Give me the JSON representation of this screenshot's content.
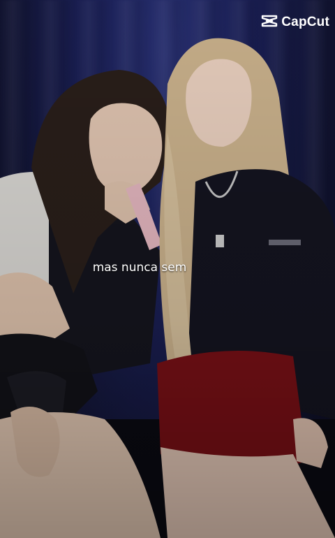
{
  "watermark": {
    "text": "CapCut",
    "icon": "capcut-logo-icon"
  },
  "caption": {
    "text": "mas nunca sem"
  },
  "colors": {
    "background": "#1b2057",
    "caption_text": "#ffffff",
    "red_skirt": "#7a1016",
    "blonde_hair": "#cdb48e"
  }
}
